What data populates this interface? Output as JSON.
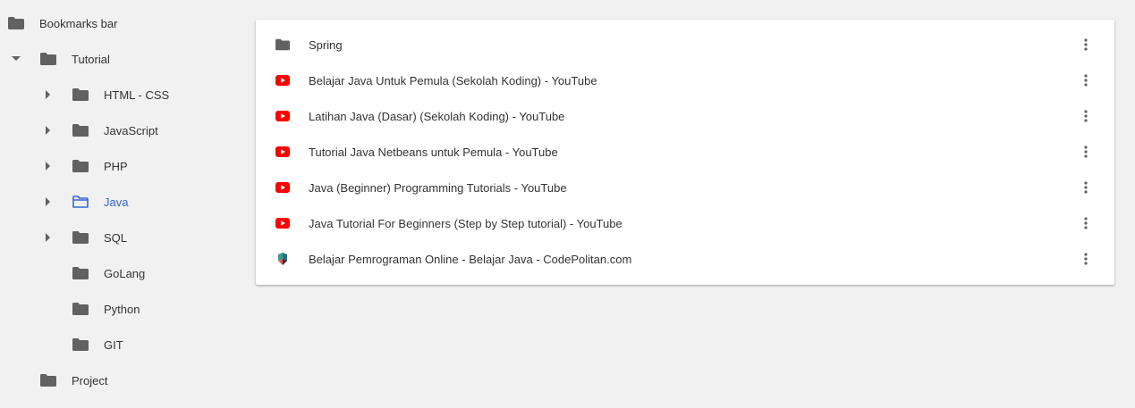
{
  "colors": {
    "background": "#f1f1f1",
    "folder": "#616161",
    "selected": "#3367d6",
    "youtube_red": "#ff0000",
    "text": "#333333"
  },
  "sidebar": {
    "items": [
      {
        "label": "Bookmarks bar",
        "icon": "folder-icon",
        "expanded": false,
        "selected": false
      },
      {
        "label": "Tutorial",
        "icon": "folder-icon",
        "expanded": true,
        "selected": false
      },
      {
        "label": "HTML - CSS",
        "icon": "folder-icon",
        "expanded": false,
        "selected": false
      },
      {
        "label": "JavaScript",
        "icon": "folder-icon",
        "expanded": false,
        "selected": false
      },
      {
        "label": "PHP",
        "icon": "folder-icon",
        "expanded": false,
        "selected": false
      },
      {
        "label": "Java",
        "icon": "folder-open-outline-icon",
        "expanded": false,
        "selected": true
      },
      {
        "label": "SQL",
        "icon": "folder-icon",
        "expanded": false,
        "selected": false
      },
      {
        "label": "GoLang",
        "icon": "folder-icon",
        "expanded": false,
        "selected": false
      },
      {
        "label": "Python",
        "icon": "folder-icon",
        "expanded": false,
        "selected": false
      },
      {
        "label": "GIT",
        "icon": "folder-icon",
        "expanded": false,
        "selected": false
      },
      {
        "label": "Project",
        "icon": "folder-icon",
        "expanded": false,
        "selected": false
      }
    ]
  },
  "list": {
    "items": [
      {
        "title": "Spring",
        "icon": "folder-icon"
      },
      {
        "title": "Belajar Java Untuk Pemula (Sekolah Koding) - YouTube",
        "icon": "youtube-icon"
      },
      {
        "title": "Latihan Java (Dasar) (Sekolah Koding) - YouTube",
        "icon": "youtube-icon"
      },
      {
        "title": "Tutorial Java Netbeans untuk Pemula - YouTube",
        "icon": "youtube-icon"
      },
      {
        "title": "Java (Beginner) Programming Tutorials - YouTube",
        "icon": "youtube-icon"
      },
      {
        "title": "Java Tutorial For Beginners (Step by Step tutorial) - YouTube",
        "icon": "youtube-icon"
      },
      {
        "title": "Belajar Pemrograman Online - Belajar Java - CodePolitan.com",
        "icon": "codepolitan-icon"
      }
    ]
  }
}
